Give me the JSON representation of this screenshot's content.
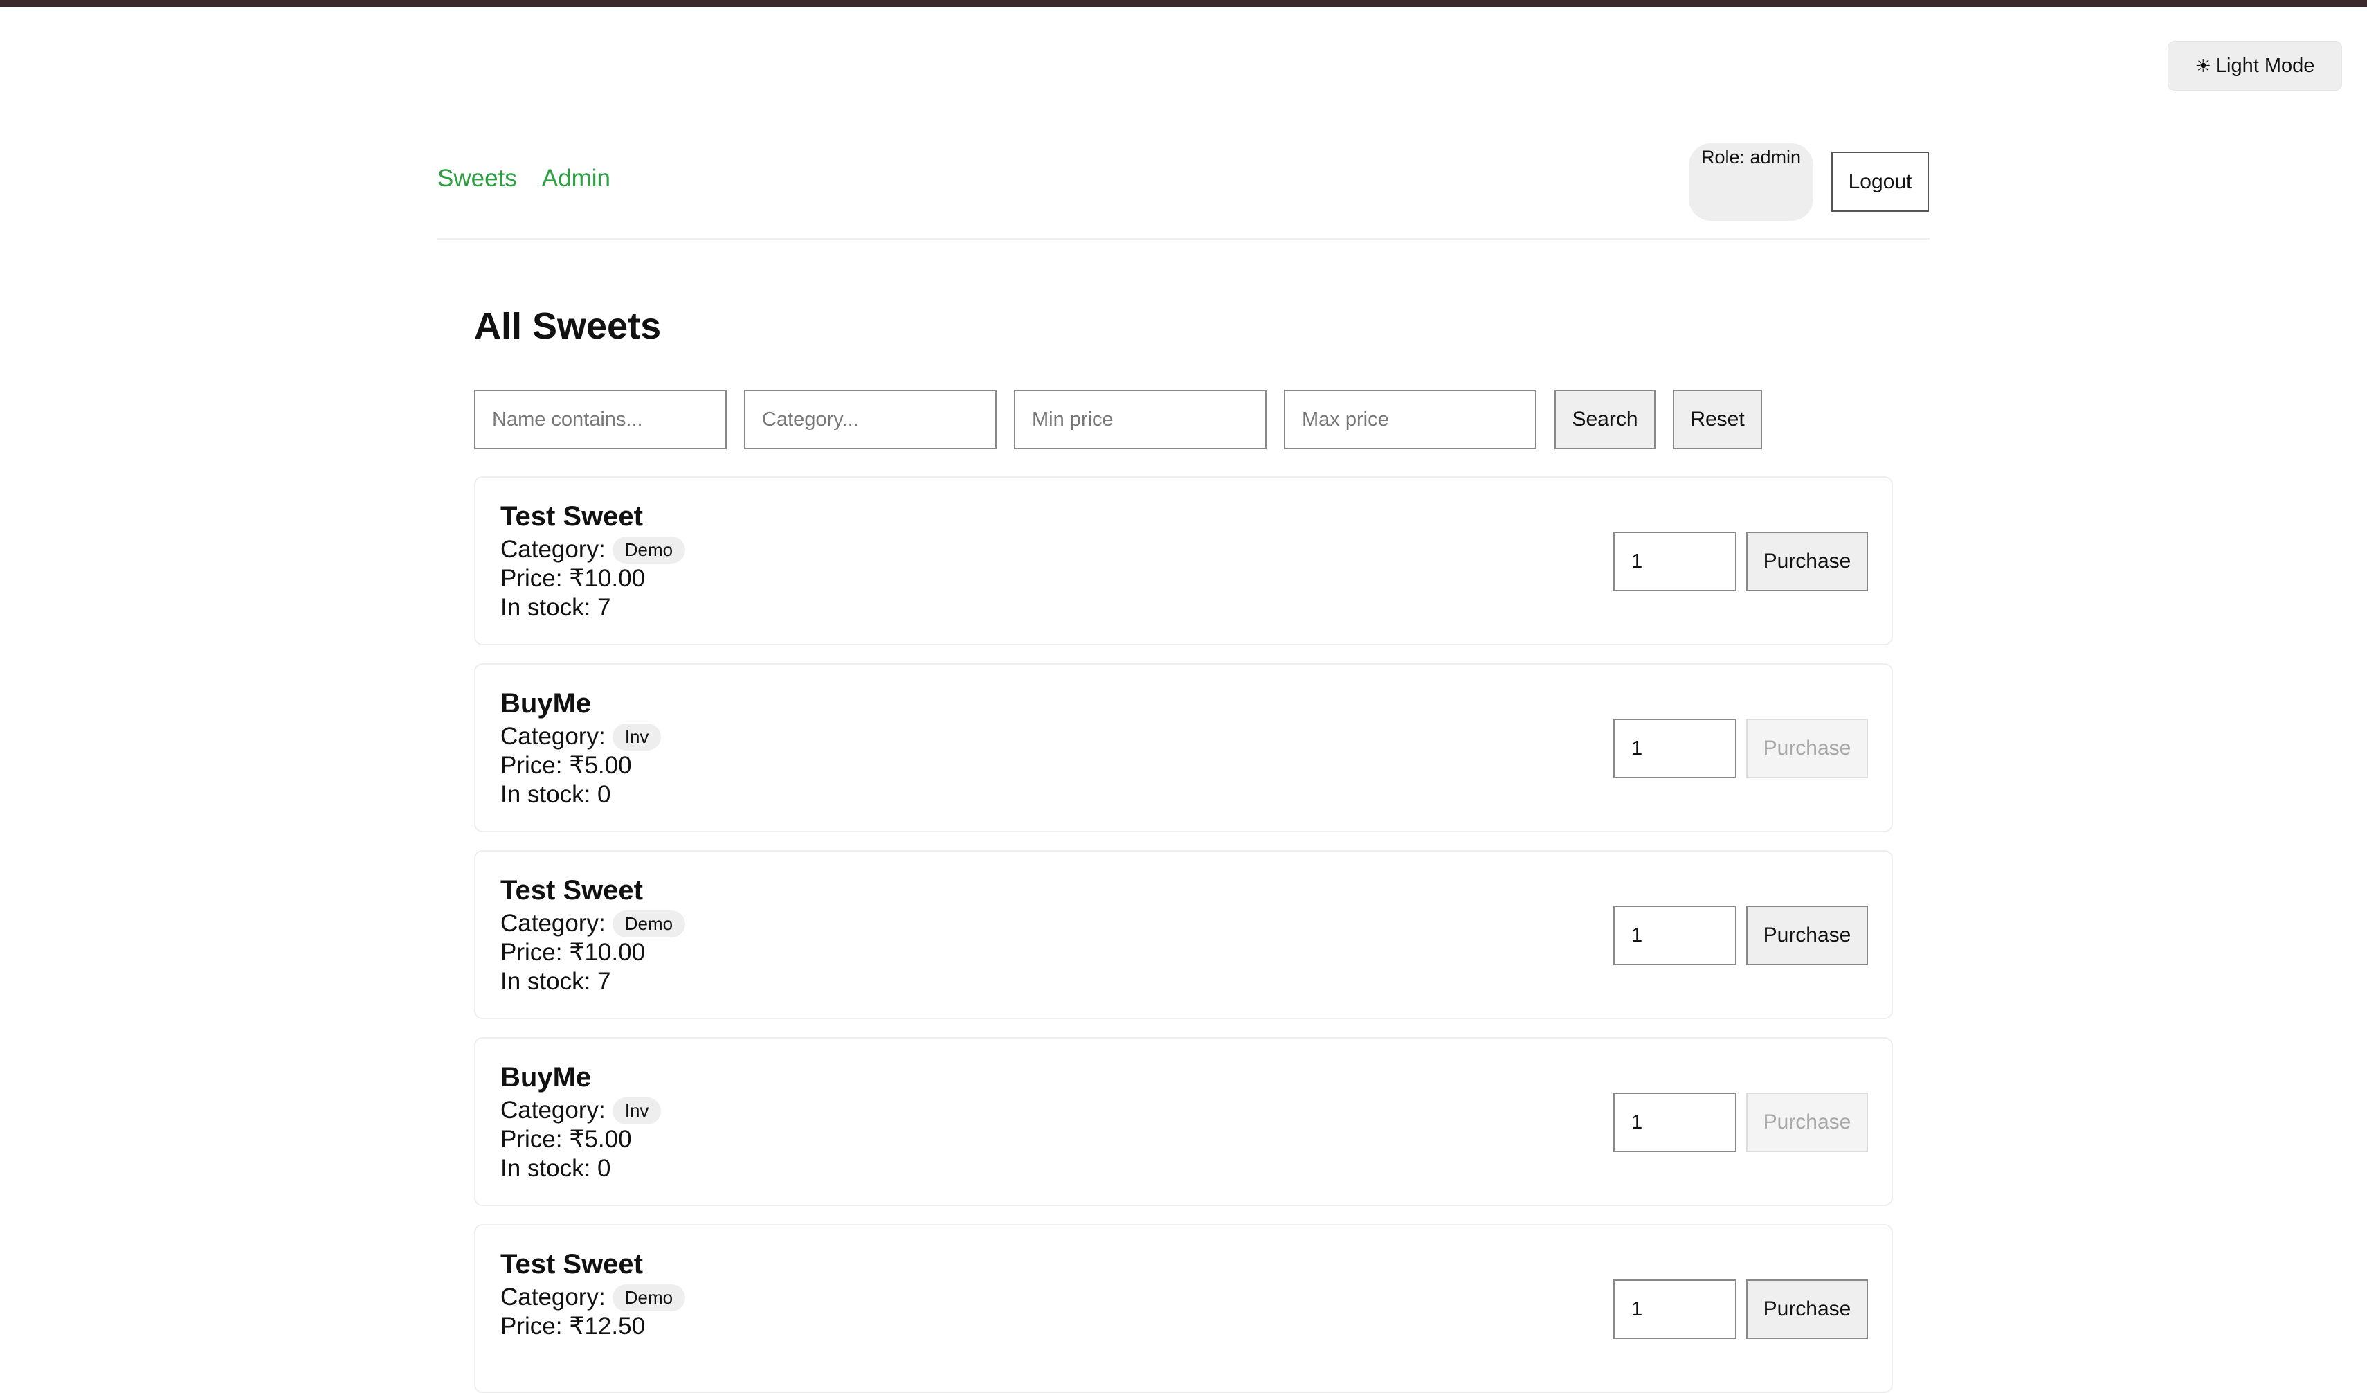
{
  "theme_toggle": {
    "icon": "sun-icon",
    "label": "Light Mode"
  },
  "nav": {
    "sweets": "Sweets",
    "admin": "Admin"
  },
  "user": {
    "role_label": "Role: admin",
    "logout_label": "Logout"
  },
  "page_title": "All Sweets",
  "filters": {
    "name_placeholder": "Name contains...",
    "category_placeholder": "Category...",
    "min_price_placeholder": "Min price",
    "max_price_placeholder": "Max price",
    "search_label": "Search",
    "reset_label": "Reset"
  },
  "labels": {
    "category": "Category:",
    "purchase": "Purchase"
  },
  "sweets": [
    {
      "name": "Test Sweet",
      "category": "Demo",
      "price": "Price: ₹10.00",
      "stock": "In stock: 7",
      "quantity": "1",
      "purchase_enabled": true
    },
    {
      "name": "BuyMe",
      "category": "Inv",
      "price": "Price: ₹5.00",
      "stock": "In stock: 0",
      "quantity": "1",
      "purchase_enabled": false
    },
    {
      "name": "Test Sweet",
      "category": "Demo",
      "price": "Price: ₹10.00",
      "stock": "In stock: 7",
      "quantity": "1",
      "purchase_enabled": true
    },
    {
      "name": "BuyMe",
      "category": "Inv",
      "price": "Price: ₹5.00",
      "stock": "In stock: 0",
      "quantity": "1",
      "purchase_enabled": false
    },
    {
      "name": "Test Sweet",
      "category": "Demo",
      "price": "Price: ₹12.50",
      "stock": "",
      "quantity": "1",
      "purchase_enabled": true
    }
  ],
  "colors": {
    "accent": "#2ea043",
    "top_bar": "#3d2a2f"
  }
}
